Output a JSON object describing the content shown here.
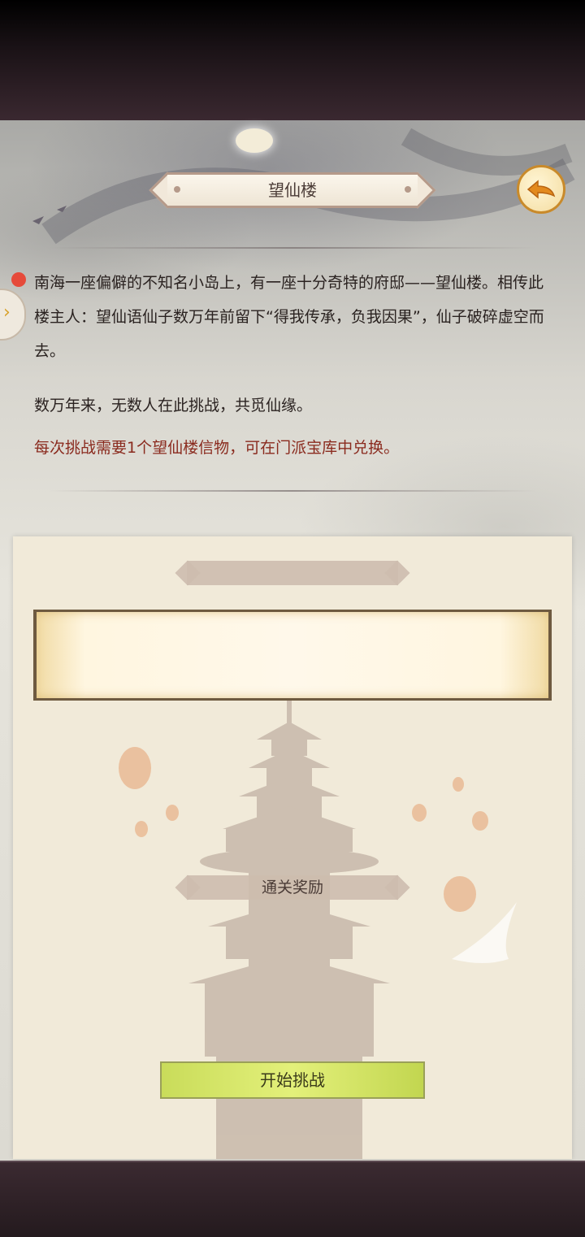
{
  "header": {
    "title": "望仙楼"
  },
  "description": {
    "intro": "南海一座偏僻的不知名小岛上，有一座十分奇特的府邸——望仙楼。相传此楼主人：望仙语仙子数万年前留下“得我传承，负我因果”，仙子破碎虚空而去。",
    "note": "数万年来，无数人在此挑战，共觅仙缘。",
    "cost_hint": "每次挑战需要1个望仙楼信物，可在门派宝库中兑换。"
  },
  "card": {
    "top_ribbon_label": "",
    "reward_label": "通关奖励",
    "start_button_label": "开始挑战"
  },
  "icons": {
    "back": "back-arrow-icon",
    "side_tab": "chevron-right-icon"
  },
  "colors": {
    "highlight_text": "#8a2a1e",
    "start_button": "#d6e86a",
    "back_button_border": "#c98a2a",
    "notification_dot": "#e64a3a"
  }
}
